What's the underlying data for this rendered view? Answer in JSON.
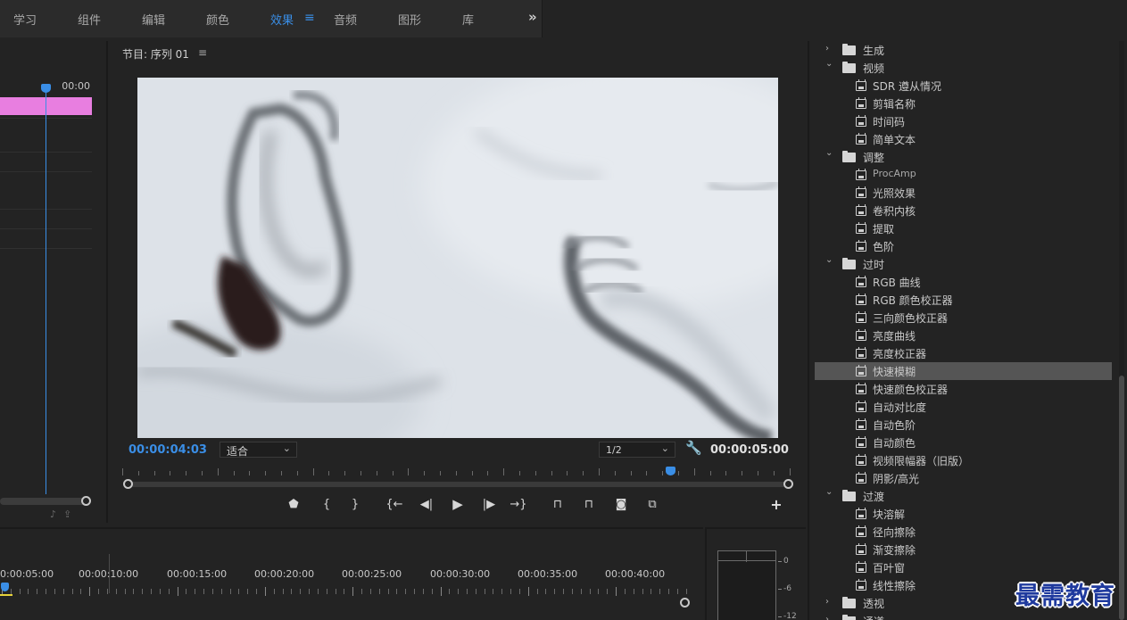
{
  "workspaces": {
    "items": [
      "学习",
      "组件",
      "编辑",
      "颜色",
      "效果",
      "音频",
      "图形",
      "库"
    ],
    "active": "效果",
    "menu_icon": "hamburger-icon",
    "more_icon": "double-chevron-right-icon"
  },
  "left_panel": {
    "timecode": "00:00",
    "clip_color": "#e87ee0",
    "icons": [
      "music-note-icon",
      "export-icon"
    ]
  },
  "program_monitor": {
    "title": "节目: 序列 01",
    "menu_icon": "hamburger-icon",
    "current_timecode": "00:00:04:03",
    "duration_timecode": "00:00:05:00",
    "fit_select": {
      "value": "适合",
      "chevron_icon": "chevron-down-icon"
    },
    "resolution_select": {
      "value": "1/2",
      "chevron_icon": "chevron-down-icon"
    },
    "settings_icon": "wrench-icon",
    "playhead_position": 0.82,
    "controls": [
      {
        "name": "add-marker-button",
        "glyph": "⬢"
      },
      {
        "name": "mark-in-button",
        "glyph": "{"
      },
      {
        "name": "mark-out-button",
        "glyph": "}"
      },
      {
        "name": "go-to-in-button",
        "glyph": "{⇤"
      },
      {
        "name": "step-back-button",
        "glyph": "◀|"
      },
      {
        "name": "play-button",
        "glyph": "▶"
      },
      {
        "name": "step-forward-button",
        "glyph": "|▶"
      },
      {
        "name": "go-to-out-button",
        "glyph": "⇥}"
      },
      {
        "name": "lift-button",
        "glyph": "⏏"
      },
      {
        "name": "extract-button",
        "glyph": "⏏"
      },
      {
        "name": "export-frame-button",
        "glyph": "📷"
      },
      {
        "name": "compare-view-button",
        "glyph": "⧉"
      }
    ],
    "add_button": "+",
    "accent": "#3a8ee6"
  },
  "effects_tree": [
    {
      "type": "folder",
      "label": "生成",
      "expanded": false
    },
    {
      "type": "folder",
      "label": "视频",
      "expanded": true
    },
    {
      "type": "effect",
      "label": "SDR 遵从情况"
    },
    {
      "type": "effect",
      "label": "剪辑名称"
    },
    {
      "type": "effect",
      "label": "时间码"
    },
    {
      "type": "effect",
      "label": "简单文本"
    },
    {
      "type": "folder",
      "label": "调整",
      "expanded": true
    },
    {
      "type": "effect",
      "label": "ProcAmp",
      "latin": true
    },
    {
      "type": "effect",
      "label": "光照效果"
    },
    {
      "type": "effect",
      "label": "卷积内核"
    },
    {
      "type": "effect",
      "label": "提取"
    },
    {
      "type": "effect",
      "label": "色阶"
    },
    {
      "type": "folder",
      "label": "过时",
      "expanded": true
    },
    {
      "type": "effect",
      "label": "RGB 曲线"
    },
    {
      "type": "effect",
      "label": "RGB 颜色校正器"
    },
    {
      "type": "effect",
      "label": "三向颜色校正器"
    },
    {
      "type": "effect",
      "label": "亮度曲线"
    },
    {
      "type": "effect",
      "label": "亮度校正器"
    },
    {
      "type": "effect",
      "label": "快速模糊",
      "selected": true
    },
    {
      "type": "effect",
      "label": "快速颜色校正器"
    },
    {
      "type": "effect",
      "label": "自动对比度"
    },
    {
      "type": "effect",
      "label": "自动色阶"
    },
    {
      "type": "effect",
      "label": "自动颜色"
    },
    {
      "type": "effect",
      "label": "视频限幅器（旧版）"
    },
    {
      "type": "effect",
      "label": "阴影/高光"
    },
    {
      "type": "folder",
      "label": "过渡",
      "expanded": true
    },
    {
      "type": "effect",
      "label": "块溶解"
    },
    {
      "type": "effect",
      "label": "径向擦除"
    },
    {
      "type": "effect",
      "label": "渐变擦除"
    },
    {
      "type": "effect",
      "label": "百叶窗"
    },
    {
      "type": "effect",
      "label": "线性擦除"
    },
    {
      "type": "folder",
      "label": "透视",
      "expanded": false
    },
    {
      "type": "folder",
      "label": "通道",
      "expanded": false
    }
  ],
  "timeline": {
    "labels": [
      "0:00:05:00",
      "00:00:10:00",
      "00:00:15:00",
      "00:00:20:00",
      "00:00:25:00",
      "00:00:30:00",
      "00:00:35:00",
      "00:00:40:00"
    ]
  },
  "audio_meter": {
    "scale": [
      "0",
      "-6",
      "-12"
    ]
  },
  "watermark": "最需教育"
}
